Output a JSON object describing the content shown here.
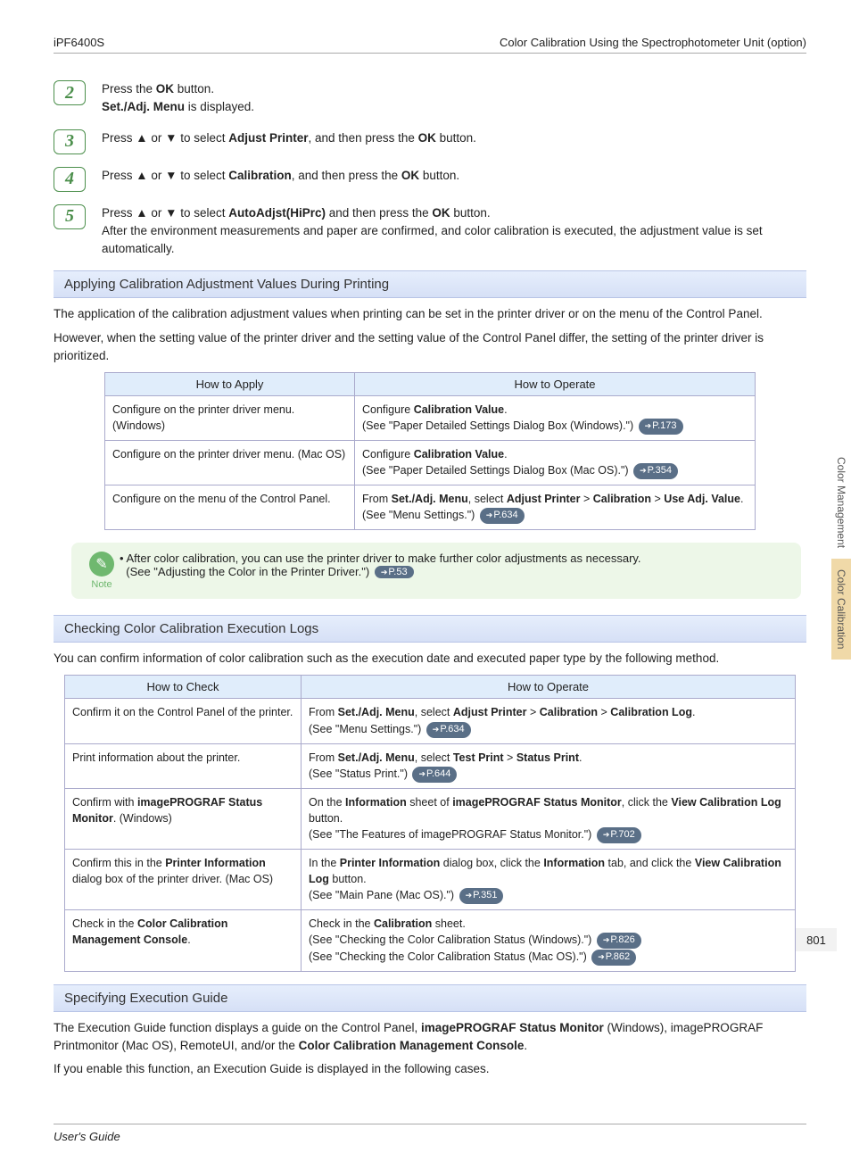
{
  "header": {
    "left": "iPF6400S",
    "right": "Color Calibration Using the Spectrophotometer Unit (option)"
  },
  "footer": {
    "left": "User's Guide",
    "right": ""
  },
  "page_number": "801",
  "side_tabs": {
    "a": "Color Management",
    "b": "Color Calibration"
  },
  "steps": {
    "s2": {
      "num": "2",
      "l1a": "Press the ",
      "l1b": "OK",
      "l1c": " button.",
      "l2a": "Set./Adj. Menu",
      "l2b": " is displayed."
    },
    "s3": {
      "num": "3",
      "l1a": "Press ▲ or ▼ to select ",
      "l1b": "Adjust Printer",
      "l1c": ", and then press the ",
      "l1d": "OK",
      "l1e": " button."
    },
    "s4": {
      "num": "4",
      "l1a": "Press ▲ or ▼ to select ",
      "l1b": "Calibration",
      "l1c": ", and then press the ",
      "l1d": "OK",
      "l1e": " button."
    },
    "s5": {
      "num": "5",
      "l1a": "Press ▲ or ▼ to select ",
      "l1b": "AutoAdjst(HiPrc)",
      "l1c": " and then press the ",
      "l1d": "OK",
      "l1e": " button.",
      "l2": "After the environment measurements and paper are confirmed, and color calibration is executed, the adjustment value is set automatically."
    }
  },
  "sec1": {
    "title": "Applying Calibration Adjustment Values During Printing",
    "p1": "The application of the calibration adjustment values when printing can be set in the printer driver or on the menu of the Control Panel.",
    "p2": "However, when the setting value of the printer driver and the setting value of the Control Panel differ, the setting of the printer driver is prioritized.",
    "th1": "How to Apply",
    "th2": "How to Operate",
    "r1c1": "Configure on the printer driver menu. (Windows)",
    "r1c2a": "Configure ",
    "r1c2b": "Calibration Value",
    "r1c2c": ".",
    "r1c2d": "(See \"Paper Detailed Settings Dialog Box (Windows).\") ",
    "r1pill": "P.173",
    "r2c1": "Configure on the printer driver menu. (Mac OS)",
    "r2c2a": "Configure ",
    "r2c2b": "Calibration Value",
    "r2c2c": ".",
    "r2c2d": "(See \"Paper Detailed Settings Dialog Box (Mac OS).\") ",
    "r2pill": "P.354",
    "r3c1": "Configure on the menu of the Control Panel.",
    "r3c2a": "From ",
    "r3c2b": "Set./Adj. Menu",
    "r3c2c": ", select ",
    "r3c2d": "Adjust Printer",
    "r3c2e": " > ",
    "r3c2f": "Calibration",
    "r3c2g": " > ",
    "r3c2h": "Use Adj. Value",
    "r3c2i": ".",
    "r3c2j": "(See \"Menu Settings.\") ",
    "r3pill": "P.634"
  },
  "note": {
    "icon_label": "Note",
    "bullet": "•",
    "l1": "After color calibration, you can use the printer driver to make further color adjustments as necessary.",
    "l2": "(See \"Adjusting the Color in the Printer Driver.\") ",
    "pill": "P.53"
  },
  "sec2": {
    "title": "Checking Color Calibration Execution Logs",
    "p1": "You can confirm information of color calibration such as the execution date and executed paper type by the following method.",
    "th1": "How to Check",
    "th2": "How to Operate",
    "r1c1": "Confirm it on the Control Panel of the printer.",
    "r1a": "From ",
    "r1b": "Set./Adj. Menu",
    "r1c": ", select ",
    "r1d": "Adjust Printer",
    "r1e": " > ",
    "r1f": "Calibration",
    "r1g": " > ",
    "r1h": "Calibration Log",
    "r1i": ".",
    "r1j": "(See \"Menu Settings.\") ",
    "r1pill": "P.634",
    "r2c1": "Print information about the printer.",
    "r2a": "From ",
    "r2b": "Set./Adj. Menu",
    "r2c": ", select ",
    "r2d": "Test Print",
    "r2e": " > ",
    "r2f": "Status Print",
    "r2g": ".",
    "r2h": "(See \"Status Print.\") ",
    "r2pill": "P.644",
    "r3c1a": "Confirm with ",
    "r3c1b": "imagePROGRAF Status Monitor",
    "r3c1c": ". (Windows)",
    "r3a": "On the ",
    "r3b": "Information",
    "r3c": " sheet of ",
    "r3d": "imagePROGRAF Status Monitor",
    "r3e": ", click the ",
    "r3f": "View Calibration Log",
    "r3g": " button.",
    "r3h": "(See \"The Features of imagePROGRAF Status Monitor.\") ",
    "r3pill": "P.702",
    "r4c1a": "Confirm this in the ",
    "r4c1b": "Printer Information",
    "r4c1c": " dialog box of the printer driver. (Mac OS)",
    "r4a": "In the ",
    "r4b": "Printer Information",
    "r4c": " dialog box, click the ",
    "r4d": "Information",
    "r4e": " tab, and click the ",
    "r4f": "View Calibration Log",
    "r4g": " button.",
    "r4h": "(See \"Main Pane (Mac OS).\") ",
    "r4pill": "P.351",
    "r5c1a": "Check in the ",
    "r5c1b": "Color Calibration Management Console",
    "r5c1c": ".",
    "r5a": "Check in the ",
    "r5b": "Calibration",
    "r5c": " sheet.",
    "r5d": "(See \"Checking the Color Calibration Status (Windows).\") ",
    "r5pill1": "P.826",
    "r5e": "(See \"Checking the Color Calibration Status (Mac OS).\") ",
    "r5pill2": "P.862"
  },
  "sec3": {
    "title": "Specifying Execution Guide",
    "p1a": "The Execution Guide function displays a guide on the Control Panel, ",
    "p1b": "imagePROGRAF Status Monitor",
    "p1c": " (Windows), imagePROGRAF Printmonitor (Mac OS), RemoteUI, and/or the ",
    "p1d": "Color Calibration Management Console",
    "p1e": ".",
    "p2": "If you enable this function, an Execution Guide is displayed in the following cases."
  }
}
